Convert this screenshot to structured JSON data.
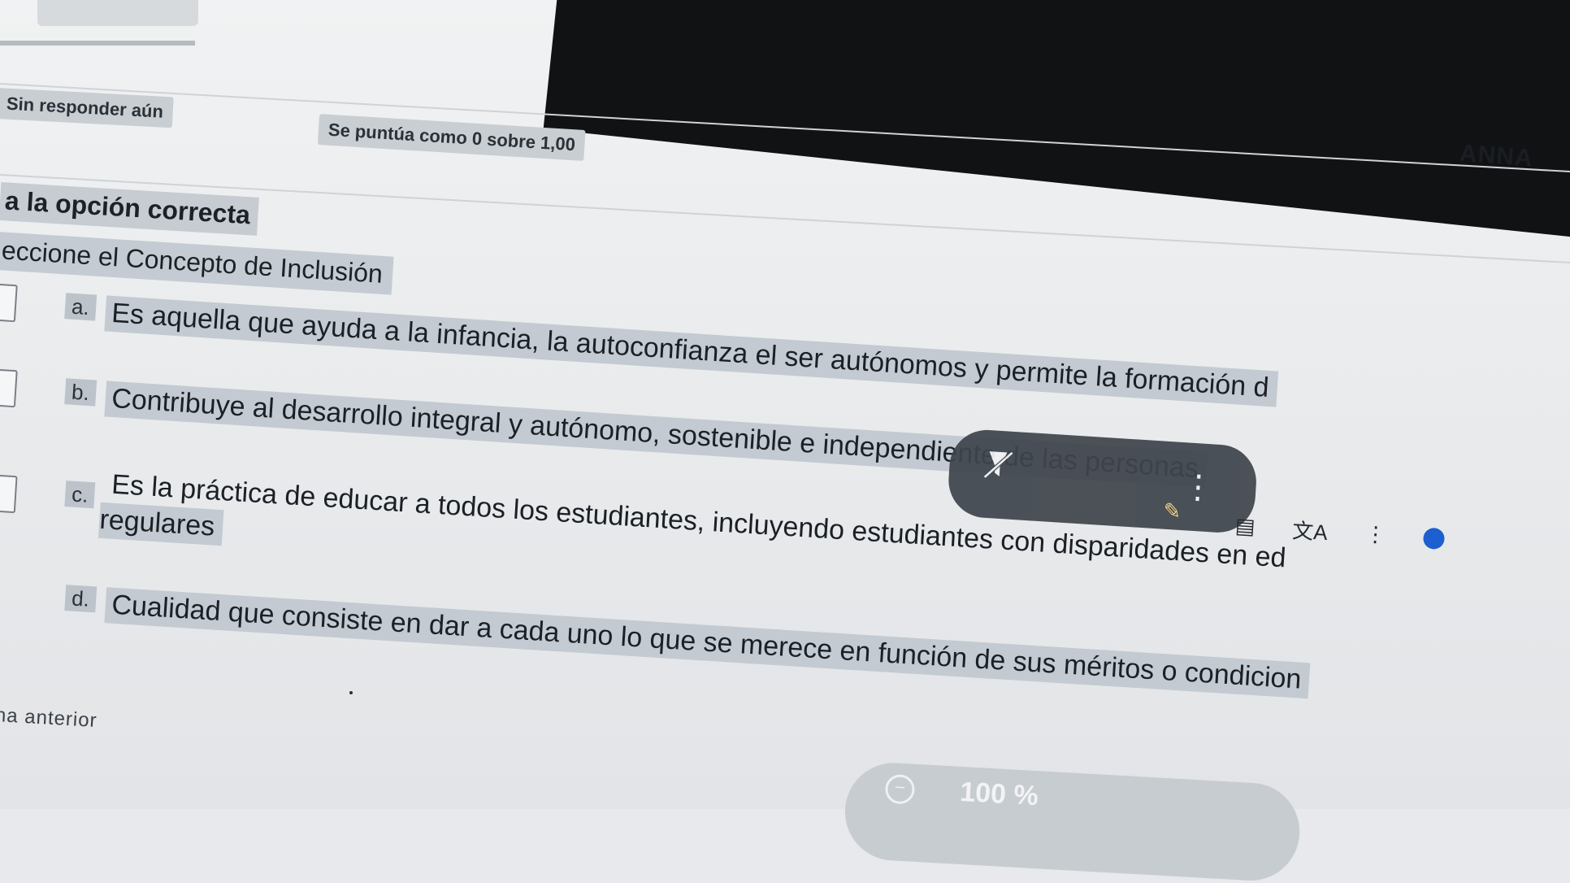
{
  "quiz": {
    "status_label": "Sin responder aún",
    "grade_label": "Se puntúa como 0 sobre 1,00",
    "user_name": "ANNA",
    "instruction": "a la opción correcta",
    "question": "eccione el Concepto de Inclusión",
    "options": [
      {
        "letter": "a.",
        "text": "Es aquella que ayuda a la infancia, la autoconfianza el ser autónomos y permite la formación d"
      },
      {
        "letter": "b.",
        "text": "Contribuye al desarrollo integral y autónomo, sostenible e independiente de las personas"
      },
      {
        "letter": "c.",
        "text_line1": "Es la práctica de educar a todos los estudiantes, incluyendo estudiantes con disparidades en ed",
        "text_line2": "regulares"
      },
      {
        "letter": "d.",
        "text": "Cualidad que consiste en dar a cada uno lo que se merece en función de sus méritos o condicion"
      }
    ],
    "prev_link": "na anterior"
  },
  "toolbar": {
    "icons": [
      "strike-pointer-icon",
      "kebab-icon",
      "pen-icon",
      "document-icon",
      "translate-icon",
      "more-icon",
      "assistant-icon"
    ]
  },
  "zoom": {
    "value": "100 %"
  }
}
